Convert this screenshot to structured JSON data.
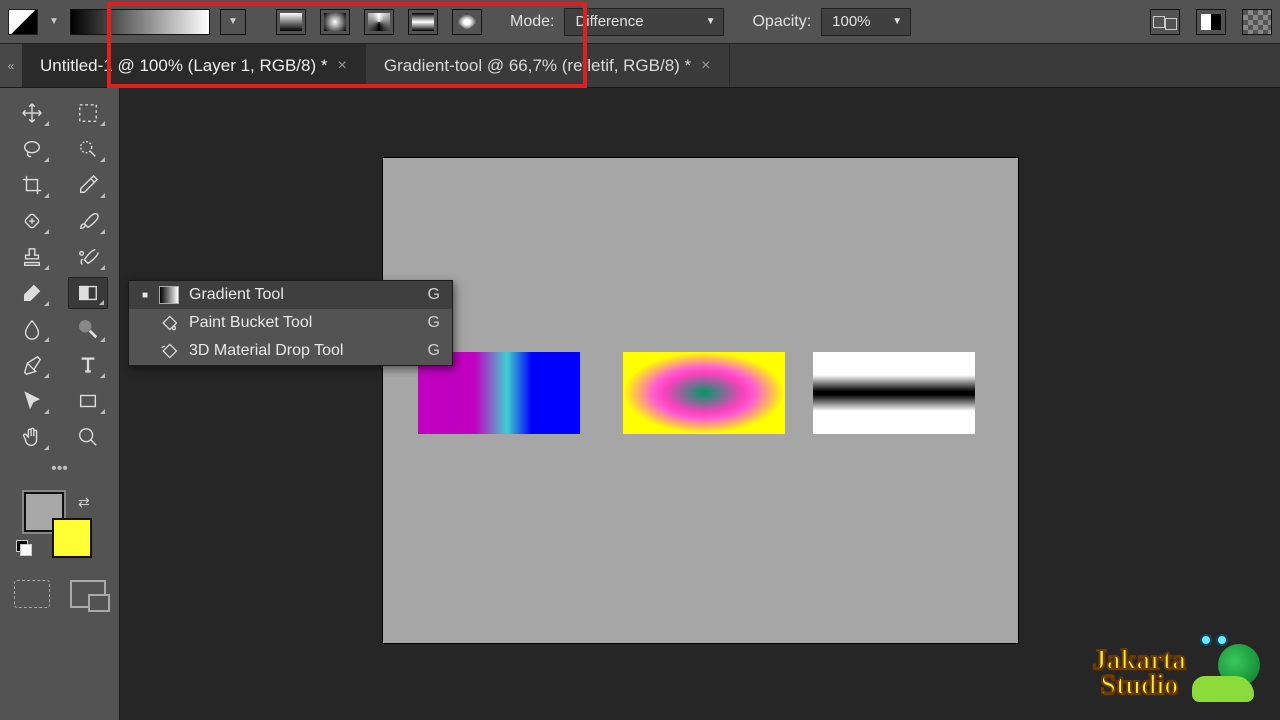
{
  "optionsBar": {
    "modeLabel": "Mode:",
    "modeValue": "Difference",
    "opacityLabel": "Opacity:",
    "opacityValue": "100%"
  },
  "tabs": [
    {
      "title": "Untitled-1 @ 100% (Layer 1, RGB/8) *",
      "active": true
    },
    {
      "title": "Gradient-tool @ 66,7% (refletif, RGB/8) *",
      "active": false
    }
  ],
  "contextMenu": {
    "items": [
      {
        "label": "Gradient Tool",
        "shortcut": "G",
        "icon": "grad",
        "selected": true
      },
      {
        "label": "Paint Bucket Tool",
        "shortcut": "G",
        "icon": "bucket",
        "selected": false
      },
      {
        "label": "3D Material Drop Tool",
        "shortcut": "G",
        "icon": "drop3d",
        "selected": false
      }
    ]
  },
  "colors": {
    "foreground": "#a8a8a8",
    "background": "#ffff33"
  },
  "watermark": {
    "line1": "Jakarta",
    "line2": "Studio"
  }
}
